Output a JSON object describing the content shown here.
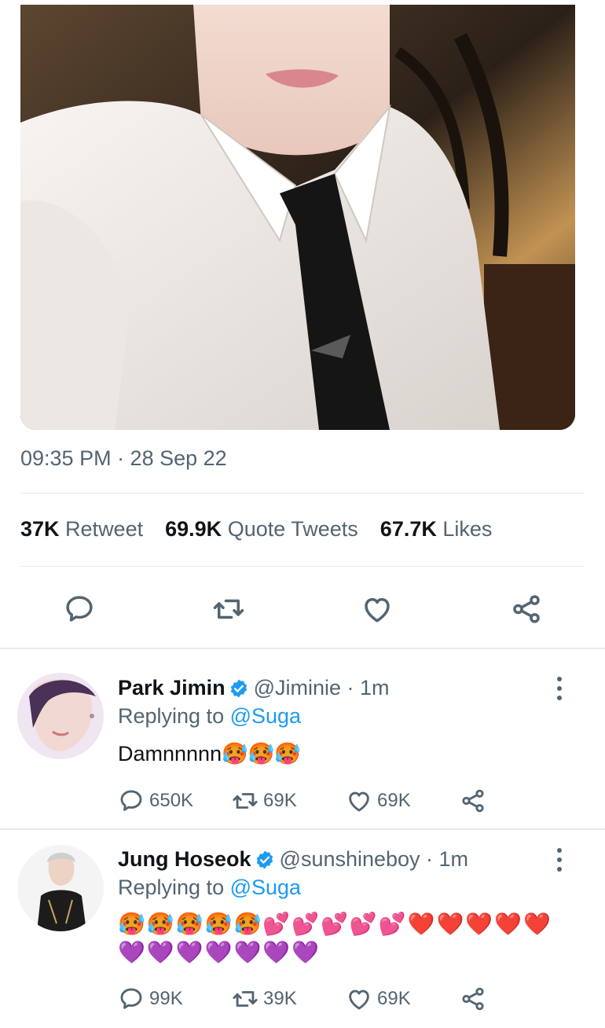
{
  "tweet": {
    "timestamp": "09:35 PM · 28 Sep 22",
    "stats": [
      {
        "value": "37K",
        "label": "Retweet"
      },
      {
        "value": "69.9K",
        "label": "Quote Tweets"
      },
      {
        "value": "67.7K",
        "label": "Likes"
      }
    ]
  },
  "replies": [
    {
      "name": "Park Jimin",
      "handle": "@Jiminie · 1m",
      "replying_prefix": "Replying to ",
      "replying_to": "@Suga",
      "text": "Damnnnnn",
      "emoji": "🥵🥵🥵",
      "counts": {
        "reply": "650K",
        "retweet": "69K",
        "like": "69K"
      }
    },
    {
      "name": "Jung Hoseok",
      "handle": "@sunshineboy · 1m",
      "replying_prefix": "Replying to ",
      "replying_to": "@Suga",
      "emoji_line1": "🥵🥵🥵🥵🥵💕💕💕💕💕❤️❤️❤️❤️❤️",
      "emoji_line2": "💜💜💜💜💜💜💜",
      "counts": {
        "reply": "99K",
        "retweet": "39K",
        "like": "69K"
      }
    }
  ],
  "colors": {
    "link": "#1d9bf0",
    "secondary_text": "#536471",
    "verified": "#1d9bf0"
  },
  "icons": [
    "comment-icon",
    "retweet-icon",
    "like-icon",
    "share-icon",
    "verified-badge-icon",
    "more-options-icon"
  ]
}
